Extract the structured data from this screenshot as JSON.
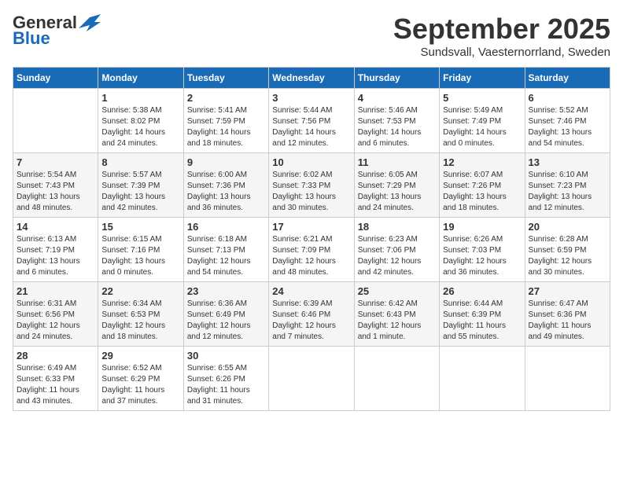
{
  "header": {
    "logo": {
      "general": "General",
      "blue": "Blue"
    },
    "title": "September 2025",
    "location": "Sundsvall, Vaesternorrland, Sweden"
  },
  "calendar": {
    "days_of_week": [
      "Sunday",
      "Monday",
      "Tuesday",
      "Wednesday",
      "Thursday",
      "Friday",
      "Saturday"
    ],
    "weeks": [
      [
        {
          "day": "",
          "info": ""
        },
        {
          "day": "1",
          "info": "Sunrise: 5:38 AM\nSunset: 8:02 PM\nDaylight: 14 hours\nand 24 minutes."
        },
        {
          "day": "2",
          "info": "Sunrise: 5:41 AM\nSunset: 7:59 PM\nDaylight: 14 hours\nand 18 minutes."
        },
        {
          "day": "3",
          "info": "Sunrise: 5:44 AM\nSunset: 7:56 PM\nDaylight: 14 hours\nand 12 minutes."
        },
        {
          "day": "4",
          "info": "Sunrise: 5:46 AM\nSunset: 7:53 PM\nDaylight: 14 hours\nand 6 minutes."
        },
        {
          "day": "5",
          "info": "Sunrise: 5:49 AM\nSunset: 7:49 PM\nDaylight: 14 hours\nand 0 minutes."
        },
        {
          "day": "6",
          "info": "Sunrise: 5:52 AM\nSunset: 7:46 PM\nDaylight: 13 hours\nand 54 minutes."
        }
      ],
      [
        {
          "day": "7",
          "info": "Sunrise: 5:54 AM\nSunset: 7:43 PM\nDaylight: 13 hours\nand 48 minutes."
        },
        {
          "day": "8",
          "info": "Sunrise: 5:57 AM\nSunset: 7:39 PM\nDaylight: 13 hours\nand 42 minutes."
        },
        {
          "day": "9",
          "info": "Sunrise: 6:00 AM\nSunset: 7:36 PM\nDaylight: 13 hours\nand 36 minutes."
        },
        {
          "day": "10",
          "info": "Sunrise: 6:02 AM\nSunset: 7:33 PM\nDaylight: 13 hours\nand 30 minutes."
        },
        {
          "day": "11",
          "info": "Sunrise: 6:05 AM\nSunset: 7:29 PM\nDaylight: 13 hours\nand 24 minutes."
        },
        {
          "day": "12",
          "info": "Sunrise: 6:07 AM\nSunset: 7:26 PM\nDaylight: 13 hours\nand 18 minutes."
        },
        {
          "day": "13",
          "info": "Sunrise: 6:10 AM\nSunset: 7:23 PM\nDaylight: 13 hours\nand 12 minutes."
        }
      ],
      [
        {
          "day": "14",
          "info": "Sunrise: 6:13 AM\nSunset: 7:19 PM\nDaylight: 13 hours\nand 6 minutes."
        },
        {
          "day": "15",
          "info": "Sunrise: 6:15 AM\nSunset: 7:16 PM\nDaylight: 13 hours\nand 0 minutes."
        },
        {
          "day": "16",
          "info": "Sunrise: 6:18 AM\nSunset: 7:13 PM\nDaylight: 12 hours\nand 54 minutes."
        },
        {
          "day": "17",
          "info": "Sunrise: 6:21 AM\nSunset: 7:09 PM\nDaylight: 12 hours\nand 48 minutes."
        },
        {
          "day": "18",
          "info": "Sunrise: 6:23 AM\nSunset: 7:06 PM\nDaylight: 12 hours\nand 42 minutes."
        },
        {
          "day": "19",
          "info": "Sunrise: 6:26 AM\nSunset: 7:03 PM\nDaylight: 12 hours\nand 36 minutes."
        },
        {
          "day": "20",
          "info": "Sunrise: 6:28 AM\nSunset: 6:59 PM\nDaylight: 12 hours\nand 30 minutes."
        }
      ],
      [
        {
          "day": "21",
          "info": "Sunrise: 6:31 AM\nSunset: 6:56 PM\nDaylight: 12 hours\nand 24 minutes."
        },
        {
          "day": "22",
          "info": "Sunrise: 6:34 AM\nSunset: 6:53 PM\nDaylight: 12 hours\nand 18 minutes."
        },
        {
          "day": "23",
          "info": "Sunrise: 6:36 AM\nSunset: 6:49 PM\nDaylight: 12 hours\nand 12 minutes."
        },
        {
          "day": "24",
          "info": "Sunrise: 6:39 AM\nSunset: 6:46 PM\nDaylight: 12 hours\nand 7 minutes."
        },
        {
          "day": "25",
          "info": "Sunrise: 6:42 AM\nSunset: 6:43 PM\nDaylight: 12 hours\nand 1 minute."
        },
        {
          "day": "26",
          "info": "Sunrise: 6:44 AM\nSunset: 6:39 PM\nDaylight: 11 hours\nand 55 minutes."
        },
        {
          "day": "27",
          "info": "Sunrise: 6:47 AM\nSunset: 6:36 PM\nDaylight: 11 hours\nand 49 minutes."
        }
      ],
      [
        {
          "day": "28",
          "info": "Sunrise: 6:49 AM\nSunset: 6:33 PM\nDaylight: 11 hours\nand 43 minutes."
        },
        {
          "day": "29",
          "info": "Sunrise: 6:52 AM\nSunset: 6:29 PM\nDaylight: 11 hours\nand 37 minutes."
        },
        {
          "day": "30",
          "info": "Sunrise: 6:55 AM\nSunset: 6:26 PM\nDaylight: 11 hours\nand 31 minutes."
        },
        {
          "day": "",
          "info": ""
        },
        {
          "day": "",
          "info": ""
        },
        {
          "day": "",
          "info": ""
        },
        {
          "day": "",
          "info": ""
        }
      ]
    ]
  }
}
